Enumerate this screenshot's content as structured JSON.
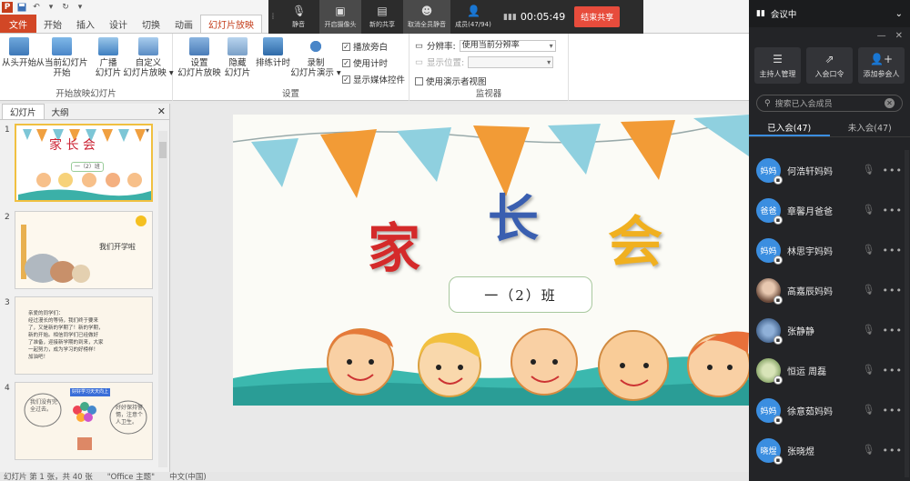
{
  "quick_access": {
    "icons": [
      "powerpoint-logo",
      "save-icon",
      "undo-icon",
      "redo-icon",
      "customize-icon"
    ]
  },
  "ribbon_tabs": [
    "文件",
    "开始",
    "插入",
    "设计",
    "切换",
    "动画",
    "幻灯片放映"
  ],
  "ribbon": {
    "group_start": {
      "label": "开始放映幻灯片",
      "buttons": [
        "从头开始",
        "从当前幻灯片\n开始",
        "广播\n幻灯片",
        "自定义\n幻灯片放映 ▾"
      ]
    },
    "group_setup": {
      "label": "设置",
      "buttons": [
        "设置\n幻灯片放映",
        "隐藏\n幻灯片",
        "排练计时",
        "录制\n幻灯片演示 ▾"
      ],
      "checks": [
        {
          "label": "播放旁白",
          "checked": true
        },
        {
          "label": "使用计时",
          "checked": true
        },
        {
          "label": "显示媒体控件",
          "checked": true
        }
      ]
    },
    "group_monitor": {
      "label": "监视器",
      "resolution_label": "分辨率:",
      "resolution_value": "使用当前分辨率",
      "display_label": "显示位置:",
      "display_value": "",
      "presenter_view": {
        "label": "使用演示者视图",
        "checked": false
      }
    }
  },
  "meeting_bar": {
    "items": [
      {
        "label": "静音",
        "icon": "mic-icon"
      },
      {
        "label": "开启摄像头",
        "icon": "camera-icon"
      },
      {
        "label": "新的共享",
        "icon": "share-icon"
      },
      {
        "label": "取消全员静音",
        "icon": "mute-all-icon"
      },
      {
        "label": "成员(47/94)",
        "icon": "members-icon"
      }
    ],
    "timer": "00:05:49",
    "end_share": "结束共享"
  },
  "left_panel": {
    "tabs": [
      "幻灯片",
      "大纲"
    ],
    "slides": [
      {
        "num": "1",
        "selected": true,
        "title": "家 长 会",
        "subtitle": "一（2）班"
      },
      {
        "num": "2",
        "selected": false,
        "title": "我们开学啦"
      },
      {
        "num": "3",
        "selected": false,
        "text": "亲爱的同学们：\n经过漫长的等待，我们终于要来\n了，又是新的学期了！新的学期，\n新的开始。相信同学们已经做好\n了准备，迎接新学期的到来，大家\n一起努力，成为学习的好榜样！\n加油吧！"
      },
      {
        "num": "4",
        "selected": false,
        "left_text": "我们没有完全过去。",
        "banner": "好好学习天天向上",
        "right_text": "好好保持警惕，注意个人卫生。"
      }
    ]
  },
  "slide": {
    "title_chars": [
      "家",
      "长",
      "会"
    ],
    "class_name": "一（2）班"
  },
  "status_bar": {
    "slide_info": "幻灯片 第 1 张，共 40 张",
    "theme": "\"Office 主题\"",
    "language": "中文(中国)"
  },
  "right_panel": {
    "header": "会议中",
    "actions": [
      {
        "label": "主持人管理",
        "icon": "settings-icon"
      },
      {
        "label": "入会口令",
        "icon": "share-out-icon"
      },
      {
        "label": "添加参会人",
        "icon": "add-user-icon"
      }
    ],
    "search_placeholder": "搜索已入会成员",
    "tabs": [
      "已入会(47)",
      "未入会(47)"
    ],
    "members": [
      {
        "avatar_text": "妈妈",
        "name": "何浩轩妈妈",
        "style": "blue"
      },
      {
        "avatar_text": "爸爸",
        "name": "章馨月爸爸",
        "style": "blue"
      },
      {
        "avatar_text": "妈妈",
        "name": "林思宇妈妈",
        "style": "blue"
      },
      {
        "avatar_text": "",
        "name": "高嘉辰妈妈",
        "style": "photo1"
      },
      {
        "avatar_text": "",
        "name": "张静静",
        "style": "photo2"
      },
      {
        "avatar_text": "",
        "name": "恒运 周磊",
        "style": "photo3"
      },
      {
        "avatar_text": "妈妈",
        "name": "徐意茹妈妈",
        "style": "blue"
      },
      {
        "avatar_text": "晓煜",
        "name": "张晓煜",
        "style": "blue"
      }
    ]
  }
}
